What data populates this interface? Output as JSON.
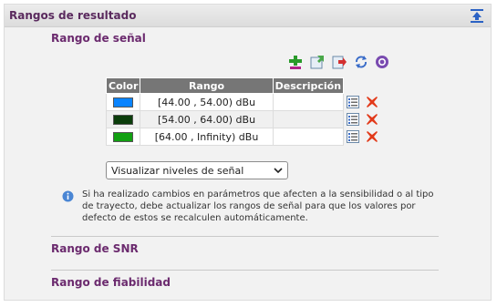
{
  "panel": {
    "title": "Rangos de resultado",
    "collapse_icon": "double-chevron-up-icon"
  },
  "signal_section": {
    "title": "Rango de señal",
    "toolbar": [
      {
        "name": "add-range-icon",
        "color": "#2a9a2a"
      },
      {
        "name": "import-icon",
        "color": "#4aa84a"
      },
      {
        "name": "export-icon",
        "color": "#d32f2f"
      },
      {
        "name": "refresh-icon",
        "color": "#3a6cc8"
      },
      {
        "name": "help-icon",
        "color": "#7a4bb0"
      }
    ],
    "table": {
      "headers": [
        "Color",
        "Rango",
        "Descripción"
      ],
      "rows": [
        {
          "color": "#0a84ff",
          "range": "[44.00 , 54.00) dBu",
          "description": ""
        },
        {
          "color": "#0b3d0b",
          "range": "[54.00 , 64.00) dBu",
          "description": ""
        },
        {
          "color": "#12a012",
          "range": "[64.00 , Infinity) dBu",
          "description": ""
        }
      ],
      "row_actions": [
        "edit-icon",
        "delete-icon"
      ]
    },
    "select": {
      "value": "Visualizar niveles de señal"
    },
    "info": "Si ha realizado cambios en parámetros que afecten a la sensibilidad o al tipo de trayecto, debe actualizar los rangos de señal para que los valores por defecto de estos se recalculen automáticamente."
  },
  "snr_section": {
    "title": "Rango de SNR"
  },
  "reliability_section": {
    "title": "Rango de fiabilidad"
  }
}
